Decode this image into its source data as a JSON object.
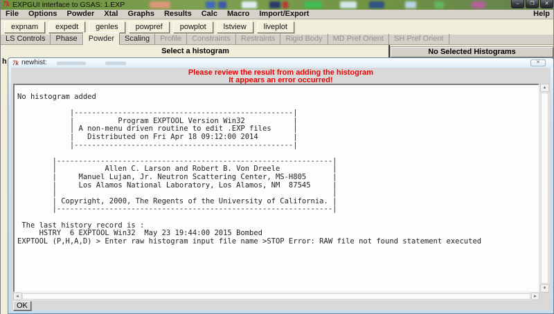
{
  "titlebar": {
    "title": "EXPGUI interface to GSAS: 1.EXP"
  },
  "icons": {
    "tk_logo": "7k",
    "minimize": "–",
    "maximize": "❐",
    "close": "✕",
    "dialog_close": "✕",
    "scroll_up": "▲",
    "scroll_down": "▼",
    "scroll_left": "◄",
    "scroll_right": "►"
  },
  "menu": {
    "items": [
      "File",
      "Options",
      "Powder",
      "Xtal",
      "Graphs",
      "Results",
      "Calc",
      "Macro",
      "Import/Export"
    ],
    "help": "Help"
  },
  "toolbar": {
    "buttons": [
      "expnam",
      "expedt",
      "genles",
      "powpref",
      "powplot",
      "lstview",
      "liveplot"
    ]
  },
  "tabs": {
    "items": [
      {
        "label": "LS Controls",
        "state": "enabled"
      },
      {
        "label": "Phase",
        "state": "enabled"
      },
      {
        "label": "Powder",
        "state": "active"
      },
      {
        "label": "Scaling",
        "state": "enabled"
      },
      {
        "label": "Profile",
        "state": "disabled"
      },
      {
        "label": "Constraints",
        "state": "disabled"
      },
      {
        "label": "Restraints",
        "state": "disabled"
      },
      {
        "label": "Rigid Body",
        "state": "disabled"
      },
      {
        "label": "MD Pref Orient",
        "state": "disabled"
      },
      {
        "label": "SH Pref Orient",
        "state": "disabled"
      }
    ]
  },
  "panels": {
    "left_header": "Select a histogram",
    "left_clipped_text": "h",
    "right_header": "No Selected Histograms"
  },
  "dialog": {
    "title": "newhist:",
    "warning_line1": "Please review the result from adding the histogram",
    "warning_line2": "It appears an error occurred!",
    "ok_label": "OK",
    "console_text": "No histogram added\n\n            |--------------------------------------------------|\n            |          Program EXPTOOL Version Win32           |\n            | A non-menu driven routine to edit .EXP files     |\n            |   Distributed on Fri Apr 18 09:12:00 2014        |\n            |--------------------------------------------------|\n\n        |---------------------------------------------------------------|\n        |           Allen C. Larson and Robert B. Von Dreele            |\n        |     Manuel Lujan, Jr. Neutron Scattering Center, MS-H805      |\n        |     Los Alamos National Laboratory, Los Alamos, NM  87545     |\n        |                                                               |\n        | Copyright, 2000, The Regents of the University of California. |\n        |---------------------------------------------------------------|\n\n The last history record is :\n     HSTRY  6 EXPTOOL Win32  May 23 19:44:00 2015 Bombed\nEXPTOOL (P,H,A,D) > Enter raw histogram input file name >STOP Error: RAW file not found statement executed"
  },
  "colors": {
    "cream": "#f0edda",
    "chrome_gray": "#d4d0c8",
    "dialog_gray": "#d9d9d9",
    "frame_blue": "#cde3f3",
    "warning_red": "#ee0000",
    "titlebar_green": "#6f9243"
  }
}
